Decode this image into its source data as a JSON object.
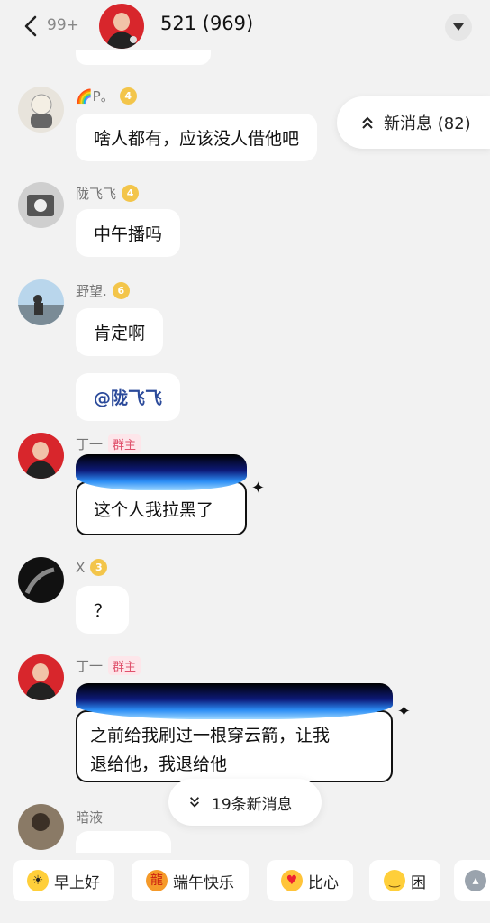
{
  "header": {
    "unread_count": "99+",
    "title": "521 (969)"
  },
  "pills": {
    "new_messages_top": "新消息 (82)",
    "new_messages_bottom": "19条新消息"
  },
  "messages": [
    {
      "sender": "🌈P。",
      "level": "4",
      "text": "啥人都有，应该没人借他吧"
    },
    {
      "sender": "陇飞飞",
      "level": "4",
      "text": "中午播吗"
    },
    {
      "sender": "野望.",
      "level": "6",
      "text": "肯定啊",
      "mention": "@陇飞飞"
    },
    {
      "sender": "丁一",
      "badge": "群主",
      "text": "这个人我拉黑了"
    },
    {
      "sender": "X",
      "level": "3",
      "text": "？"
    },
    {
      "sender": "丁一",
      "badge": "群主",
      "text_line1": "之前给我刷过一根穿云箭，让我",
      "text_line2": "退给他，我退给他"
    },
    {
      "sender": "暗液"
    }
  ],
  "quick_replies": [
    {
      "label": "早上好",
      "icon": "sun-face-icon"
    },
    {
      "label": "端午快乐",
      "icon": "dragon-icon"
    },
    {
      "label": "比心",
      "icon": "heart-hands-icon"
    },
    {
      "label": "困",
      "icon": "sleepy-face-icon"
    },
    {
      "label": "",
      "icon": "husky-icon"
    }
  ],
  "colors": {
    "background": "#f2f2f2",
    "bubble": "#ffffff",
    "owner_badge": "#e0506b",
    "level_badge": "#f3c54a",
    "mention": "#2b4a9a"
  }
}
